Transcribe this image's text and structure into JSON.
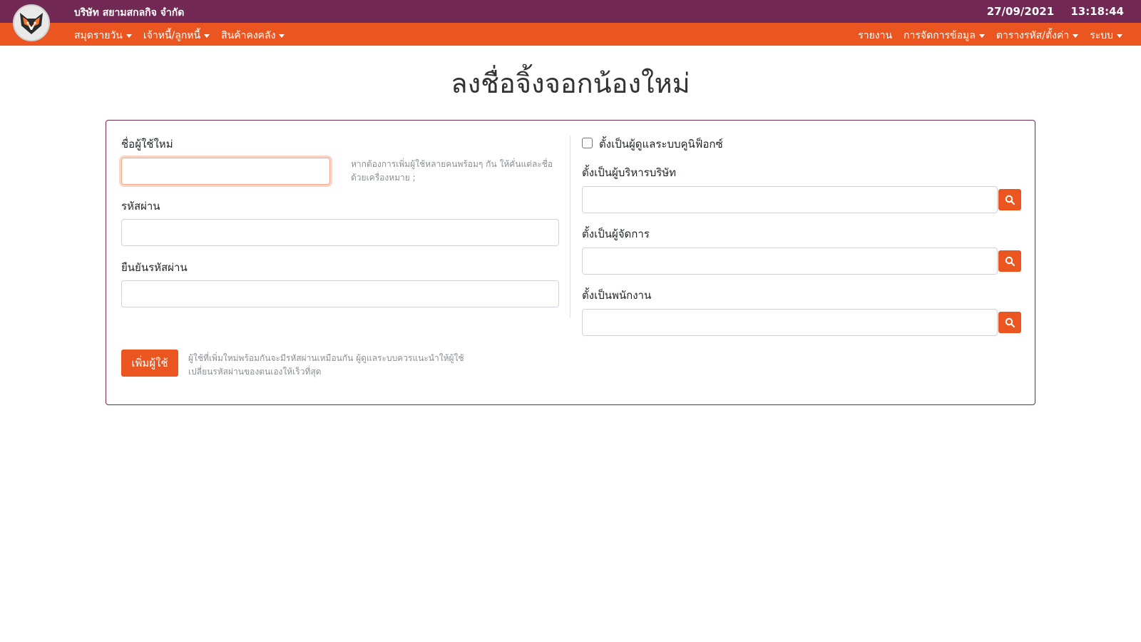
{
  "header": {
    "company": "บริษัท สยามสกลกิจ จำกัด",
    "date": "27/09/2021",
    "time": "13:18:44"
  },
  "nav": {
    "left": [
      {
        "label": "สมุดรายวัน"
      },
      {
        "label": "เจ้าหนี้/ลูกหนี้"
      },
      {
        "label": "สินค้าคงคลัง"
      }
    ],
    "right": [
      {
        "label": "รายงาน"
      },
      {
        "label": "การจัดการข้อมูล"
      },
      {
        "label": "ตารางรหัส/ตั้งค่า"
      },
      {
        "label": "ระบบ"
      }
    ]
  },
  "page_title": "ลงชื่อจิ้งจอกน้องใหม่",
  "form": {
    "username_label": "ชื่อผู้ใช้ใหม่",
    "username_value": "",
    "username_hint": "หากต้องการเพิ่มผู้ใช้หลายคนพร้อมๆ กัน ให้คั่นแต่ละชื่อด้วยเครื่องหมาย ;",
    "password_label": "รหัสผ่าน",
    "password_value": "",
    "confirm_label": "ยืนยันรหัสผ่าน",
    "confirm_value": "",
    "admin_checkbox_label": "ตั้งเป็นผู้ดูแลระบบคูนิฟ็อกซ์",
    "admin_checked": false,
    "exec_label": "ตั้งเป็นผู้บริหารบริษัท",
    "exec_value": "",
    "manager_label": "ตั้งเป็นผู้จัดการ",
    "manager_value": "",
    "staff_label": "ตั้งเป็นพนักงาน",
    "staff_value": "",
    "add_button": "เพิ่มผู้ใช้",
    "add_hint": "ผู้ใช้ที่เพิ่มใหม่พร้อมกันจะมีรหัสผ่านเหมือนกัน ผู้ดูแลระบบควรแนะนำให้ผู้ใช้เปลี่ยนรหัสผ่านของตนเองให้เร็วที่สุด"
  },
  "colors": {
    "topbar": "#722854",
    "navbar": "#ea5520",
    "accent": "#ea5520"
  },
  "icons": {
    "logo": "fox-logo-icon",
    "search": "search-icon"
  }
}
